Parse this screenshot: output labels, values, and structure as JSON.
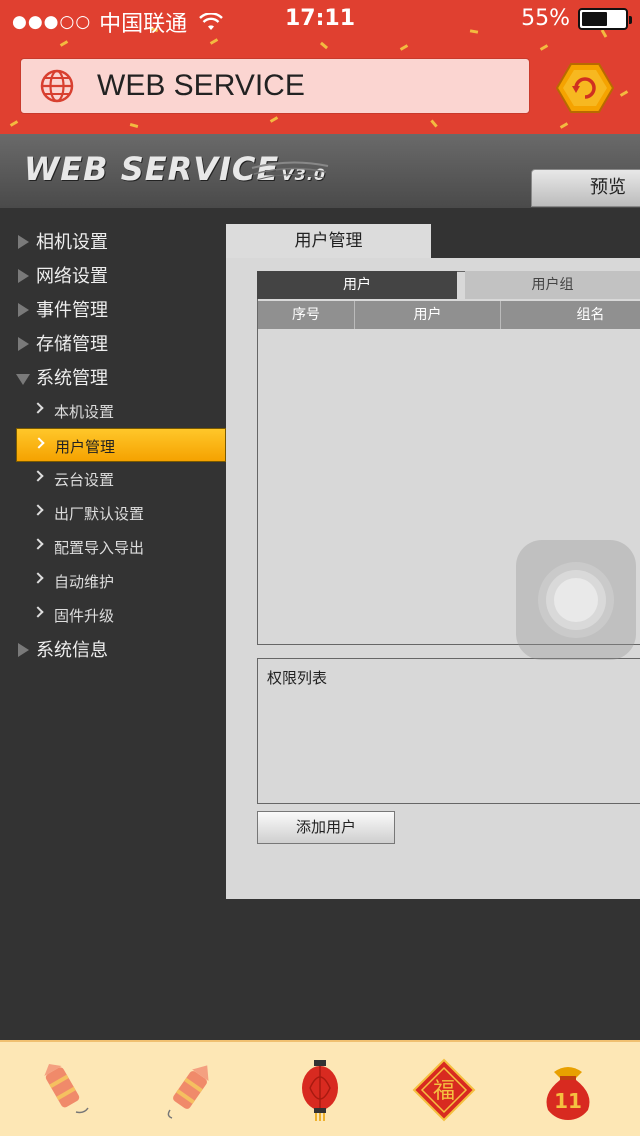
{
  "status_bar": {
    "signal": "●●●○○",
    "carrier": "中国联通",
    "time": "17:11",
    "battery": "55%"
  },
  "url_bar": {
    "title": "WEB SERVICE"
  },
  "header": {
    "logo_main": "WEB  SERVICE",
    "logo_version": "V3.0",
    "preview_button": "预览"
  },
  "sidebar": {
    "groups": [
      {
        "label": "相机设置",
        "expanded": false
      },
      {
        "label": "网络设置",
        "expanded": false
      },
      {
        "label": "事件管理",
        "expanded": false
      },
      {
        "label": "存储管理",
        "expanded": false
      },
      {
        "label": "系统管理",
        "expanded": true
      },
      {
        "label": "系统信息",
        "expanded": false
      }
    ],
    "sub_items": [
      {
        "label": "本机设置",
        "active": false
      },
      {
        "label": "用户管理",
        "active": true
      },
      {
        "label": "云台设置",
        "active": false
      },
      {
        "label": "出厂默认设置",
        "active": false
      },
      {
        "label": "配置导入导出",
        "active": false
      },
      {
        "label": "自动维护",
        "active": false
      },
      {
        "label": "固件升级",
        "active": false
      }
    ]
  },
  "main": {
    "tab_title": "用户管理",
    "subtabs": {
      "user": "用户",
      "group": "用户组"
    },
    "table_headers": [
      "序号",
      "用户",
      "组名"
    ],
    "permission_title": "权限列表",
    "add_user_button": "添加用户"
  },
  "bottom_bar": {
    "icons": [
      "firecracker-icon",
      "firecracker-rocket-icon",
      "lantern-icon",
      "fu-diamond-icon",
      "lucky-bag-icon"
    ],
    "lucky_bag_number": "11",
    "fu_char": "福"
  },
  "colors": {
    "top_red": "#e04030",
    "active_item": "#ffc72a",
    "sidebar_bg": "#333333",
    "panel_bg": "#d8d8d8",
    "bottom_bar_bg": "#fde7b5"
  }
}
